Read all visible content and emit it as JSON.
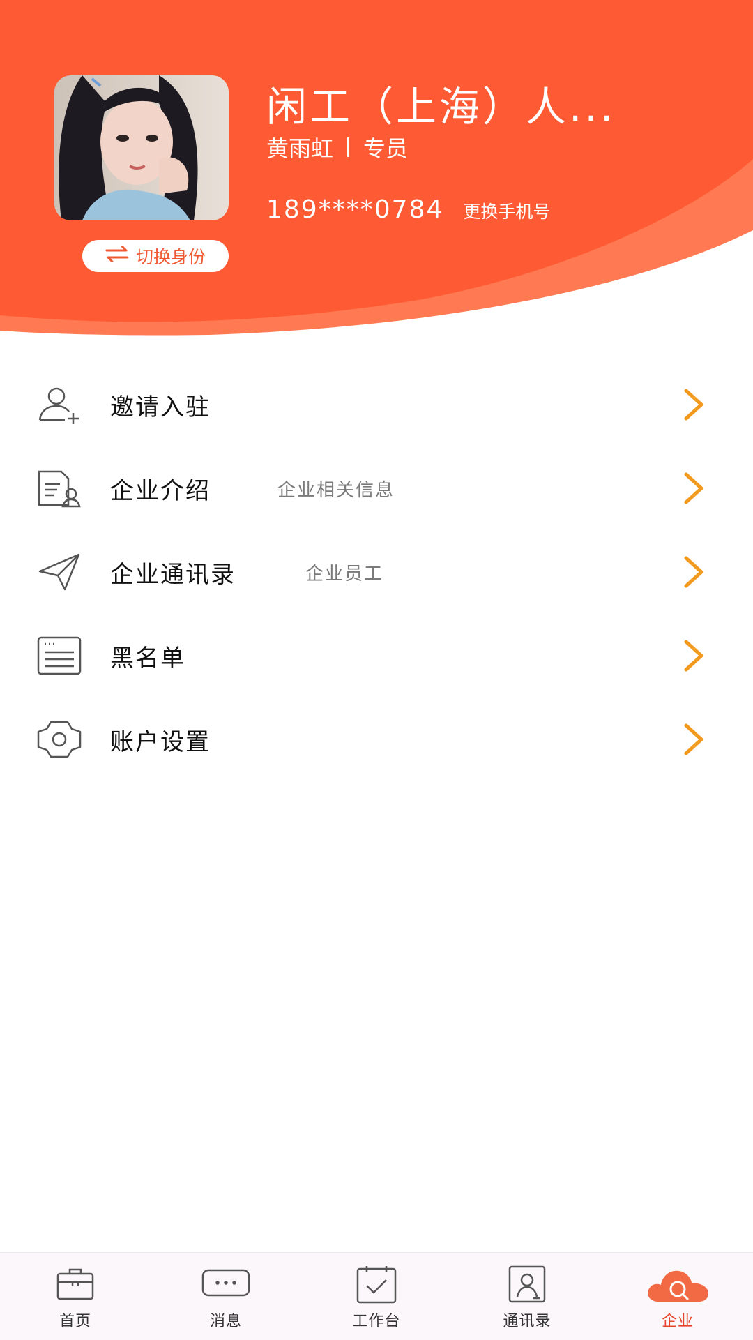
{
  "profile": {
    "company_name": "闲工（上海）人...",
    "user_name": "黄雨虹",
    "role": "专员",
    "phone": "189****0784",
    "change_phone_label": "更换手机号",
    "switch_identity_label": "切换身份"
  },
  "menu": {
    "items": [
      {
        "label": "邀请入驻",
        "sub": "",
        "icon": "add-user-icon"
      },
      {
        "label": "企业介绍",
        "sub": "企业相关信息",
        "icon": "document-user-icon"
      },
      {
        "label": "企业通讯录",
        "sub": "企业员工",
        "icon": "send-icon"
      },
      {
        "label": "黑名单",
        "sub": "",
        "icon": "list-icon"
      },
      {
        "label": "账户设置",
        "sub": "",
        "icon": "gear-icon"
      }
    ]
  },
  "bottom_nav": {
    "items": [
      {
        "label": "首页",
        "icon": "briefcase-icon"
      },
      {
        "label": "消息",
        "icon": "message-icon"
      },
      {
        "label": "工作台",
        "icon": "calendar-check-icon"
      },
      {
        "label": "通讯录",
        "icon": "contacts-icon"
      },
      {
        "label": "企业",
        "icon": "cloud-search-icon",
        "active": true
      }
    ]
  },
  "colors": {
    "header": "#fe5a33",
    "header_wave": "#ff7a52",
    "chevron": "#f29a1e",
    "active_tab": "#e5452b"
  }
}
